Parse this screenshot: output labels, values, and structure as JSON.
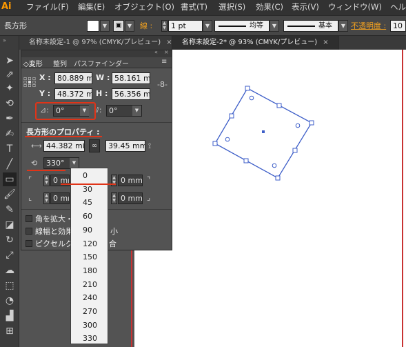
{
  "app": {
    "logo": "Ai",
    "menus": [
      "ファイル(F)",
      "編集(E)",
      "オブジェクト(O)",
      "書式(T)",
      "選択(S)",
      "効果(C)",
      "表示(V)",
      "ウィンドウ(W)",
      "ヘル"
    ]
  },
  "control_bar": {
    "tool_name": "長方形",
    "stroke_label": "線 :",
    "stroke_value": "1 pt",
    "stroke_profile": "均等",
    "brush": "基本",
    "opacity_label": "不透明度 :",
    "opacity_value": "10"
  },
  "tabs": [
    {
      "label": "名称未設定-1 @ 97% (CMYK/プレビュー)",
      "close": "×"
    },
    {
      "label": "名称未設定-2* @ 93% (CMYK/プレビュー)",
      "close": "×"
    }
  ],
  "panel": {
    "tabs": [
      "◇変形",
      "整列",
      "パスファインダー"
    ],
    "x_label": "X :",
    "x_value": "80.889 mi",
    "w_label": "W :",
    "w_value": "58.161 mi",
    "y_label": "Y :",
    "y_value": "48.372 mi",
    "h_label": "H :",
    "h_value": "56.356 mi",
    "rotate_value": "0°",
    "shear_value": "0°",
    "rect_props_title": "長方形のプロパティ :",
    "rect_w_value": "44.382 mi",
    "rect_h_value": "39.45 mm",
    "rect_angle_value": "330°",
    "corner_tl_value": "0 mm",
    "corner_tr_value": "0 mm",
    "corner_bl_value": "0 mm",
    "corner_br_value": "0 mm",
    "cb1_label": "角を拡大・",
    "cb2_label": "線幅と効果",
    "cb2_tail": "小",
    "cb3_label": "ピクセルグ",
    "cb3_tail": "合"
  },
  "dropdown": {
    "options": [
      "0",
      "30",
      "45",
      "60",
      "90",
      "120",
      "150",
      "180",
      "210",
      "240",
      "270",
      "300",
      "330"
    ]
  },
  "colors": {
    "annotation_red": "#e03418",
    "selection_blue": "#3d5ec8",
    "ui_dark": "#535353",
    "menu_bg": "#323232"
  }
}
